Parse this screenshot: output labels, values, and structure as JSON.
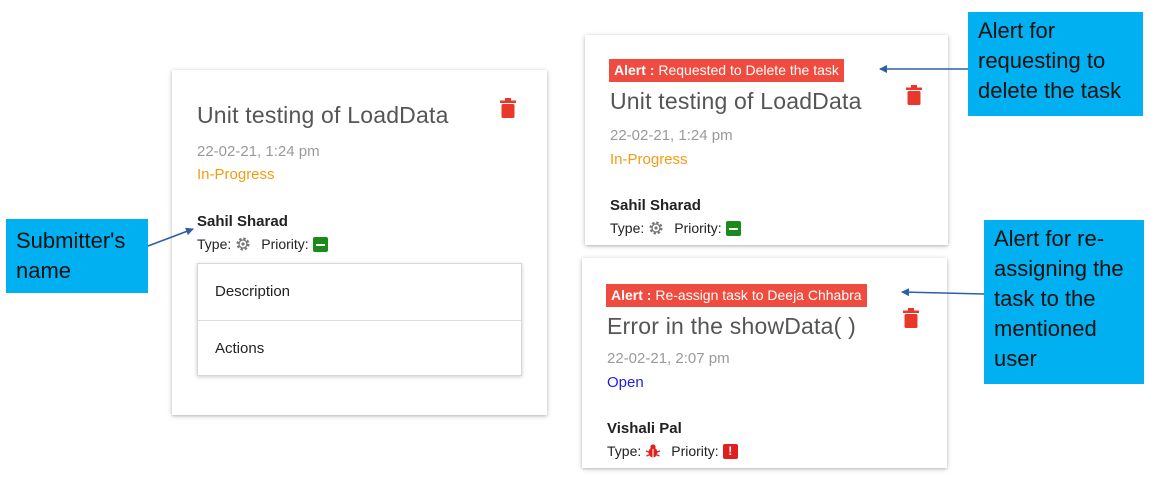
{
  "cards": [
    {
      "title": "Unit testing of LoadData",
      "date": "22-02-21, 1:24 pm",
      "status": "In-Progress",
      "submitter": "Sahil Sharad",
      "type_label": "Type:",
      "type_icon": "gear-icon",
      "priority_label": "Priority:",
      "priority": "medium",
      "delete_icon": "trash-icon",
      "menu": [
        "Description",
        "Actions"
      ]
    },
    {
      "alert_label": "Alert :",
      "alert_text": "Requested to Delete the task",
      "title": "Unit testing of LoadData",
      "date": "22-02-21, 1:24 pm",
      "status": "In-Progress",
      "submitter": "Sahil Sharad",
      "type_label": "Type:",
      "type_icon": "gear-icon",
      "priority_label": "Priority:",
      "priority": "medium",
      "delete_icon": "trash-icon"
    },
    {
      "alert_label": "Alert :",
      "alert_text": "Re-assign task to Deeja Chhabra",
      "title": "Error in the showData( )",
      "date": "22-02-21, 2:07 pm",
      "status": "Open",
      "submitter": "Vishali Pal",
      "type_label": "Type:",
      "type_icon": "bug-icon",
      "priority_label": "Priority:",
      "priority": "high",
      "priority_glyph": "!",
      "delete_icon": "trash-icon"
    }
  ],
  "callouts": {
    "submitter": "Submitter's name",
    "delete": "Alert for requesting to delete the task",
    "reassign": "Alert for re-assigning the task to the mentioned user"
  },
  "colors": {
    "alert": "#ef4b3f",
    "in_progress": "#f39c12",
    "open": "#1e1ee6",
    "callout": "#00b0f0",
    "trash": "#e8382c",
    "priority_medium": "#1a8a1a",
    "priority_high": "#e02020"
  }
}
